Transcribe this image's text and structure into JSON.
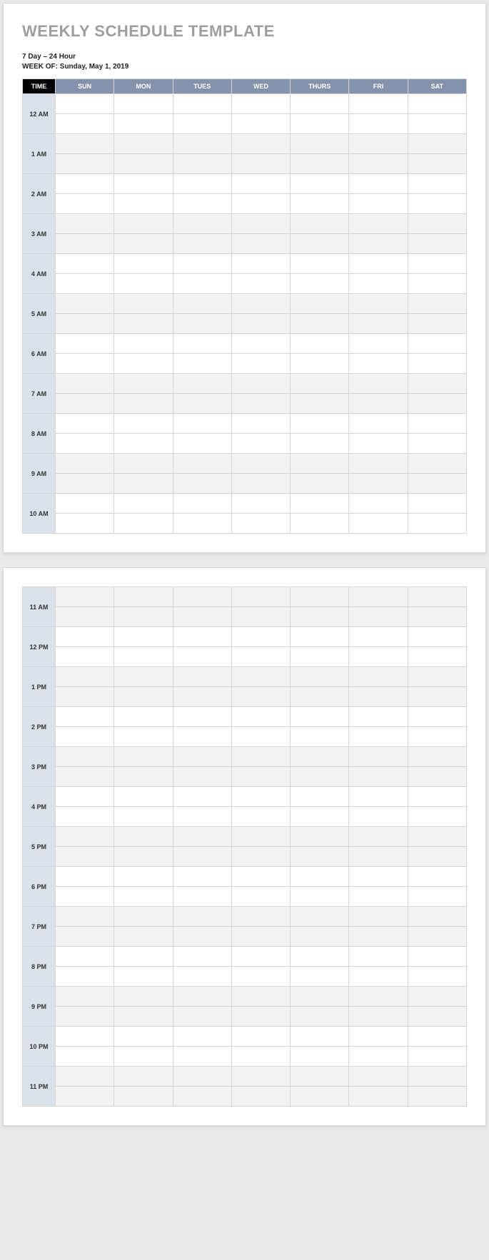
{
  "title": "WEEKLY SCHEDULE TEMPLATE",
  "meta_line1": "7 Day – 24 Hour",
  "meta_line2_label": "WEEK OF: ",
  "meta_line2_value": "Sunday, May 1, 2019",
  "headers": {
    "time": "TIME",
    "days": [
      "SUN",
      "MON",
      "TUES",
      "WED",
      "THURS",
      "FRI",
      "SAT"
    ]
  },
  "page1_hours": [
    "12 AM",
    "1 AM",
    "2 AM",
    "3 AM",
    "4 AM",
    "5 AM",
    "6 AM",
    "7 AM",
    "8 AM",
    "9 AM",
    "10 AM"
  ],
  "page2_hours": [
    "11 AM",
    "12 PM",
    "1 PM",
    "2 PM",
    "3 PM",
    "4 PM",
    "5 PM",
    "6 PM",
    "7 PM",
    "8 PM",
    "9 PM",
    "10 PM",
    "11 PM"
  ],
  "page1_shading": [
    false,
    true,
    false,
    true,
    false,
    true,
    false,
    true,
    false,
    true,
    false
  ],
  "page2_shading": [
    true,
    false,
    true,
    false,
    true,
    false,
    true,
    false,
    true,
    false,
    true,
    false,
    true
  ]
}
